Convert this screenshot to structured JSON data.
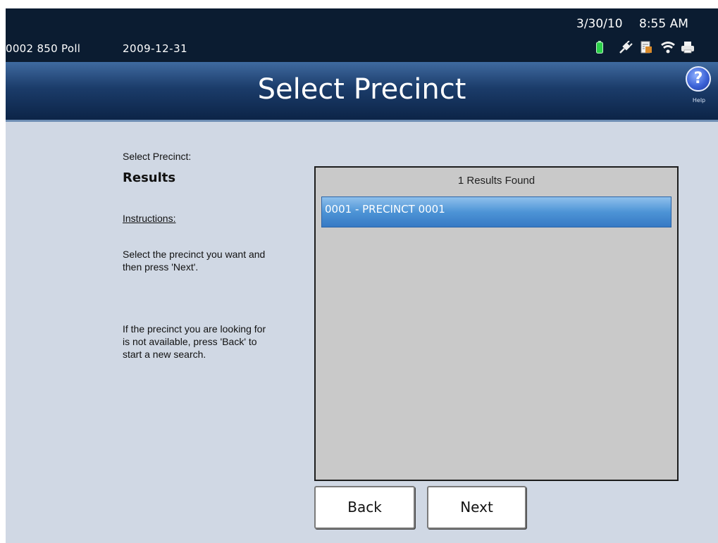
{
  "status_bar": {
    "station": "0002 850 Poll",
    "poll_date": "2009-12-31",
    "date": "3/30/10",
    "time": "8:55 AM",
    "icons": [
      "battery-icon",
      "power-plug-icon",
      "document-icon",
      "network-icon",
      "printer-icon"
    ],
    "colors": {
      "battery": "#2bd14a",
      "background": "#0b1c31"
    }
  },
  "header": {
    "title": "Select Precinct",
    "help_label": "Help",
    "help_glyph": "?"
  },
  "instructions": {
    "step_label": "Select Precinct:",
    "step_heading": "Results",
    "heading": "Instructions:",
    "paragraph1": "Select the precinct you want and then press 'Next'.",
    "paragraph2": "If the precinct you are looking for is not available, press 'Back' to start a new search."
  },
  "results": {
    "count_text": "1 Results Found",
    "items": [
      {
        "label": "0001 - PRECINCT 0001",
        "selected": true
      }
    ],
    "colors": {
      "panel": "#c9c9c9",
      "selected_row": "#4d94d6"
    }
  },
  "buttons": {
    "back_label": "Back",
    "next_label": "Next"
  }
}
